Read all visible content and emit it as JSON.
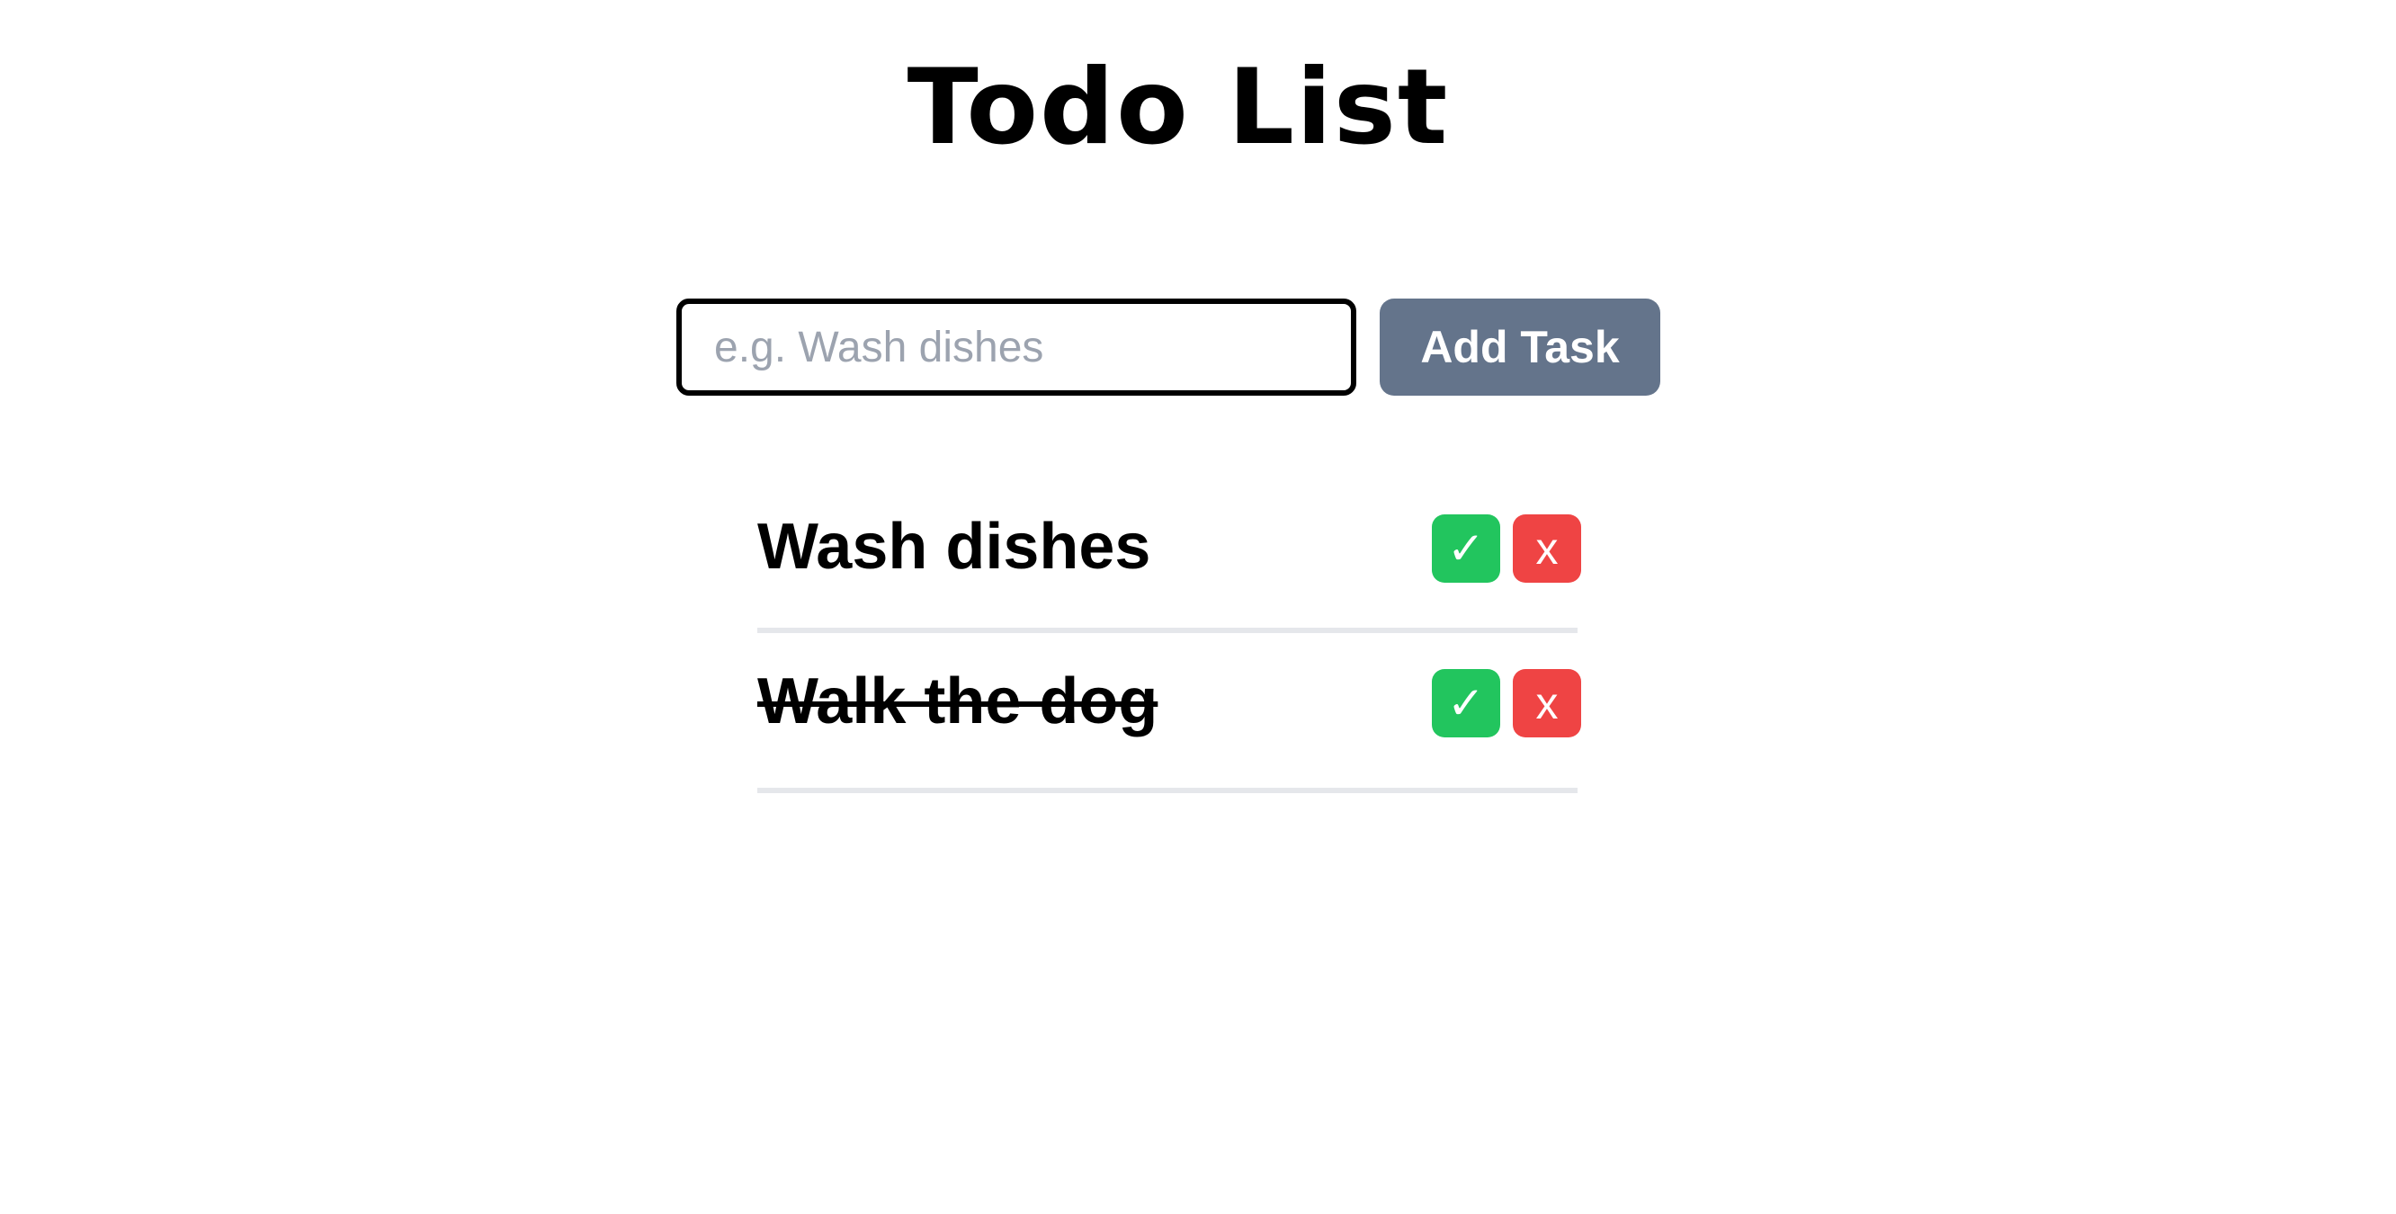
{
  "app": {
    "title": "Todo List"
  },
  "form": {
    "input_value": "",
    "input_placeholder": "e.g. Wash dishes",
    "add_label": "Add Task"
  },
  "tasks": [
    {
      "text": "Wash dishes",
      "completed": false,
      "complete_label": "✓",
      "delete_label": "x"
    },
    {
      "text": "Walk the dog",
      "completed": true,
      "complete_label": "✓",
      "delete_label": "x"
    }
  ],
  "colors": {
    "add_button": "#64748b",
    "complete_button": "#22c55e",
    "delete_button": "#ef4444",
    "divider": "#e5e7eb",
    "placeholder": "#9ca3af"
  }
}
